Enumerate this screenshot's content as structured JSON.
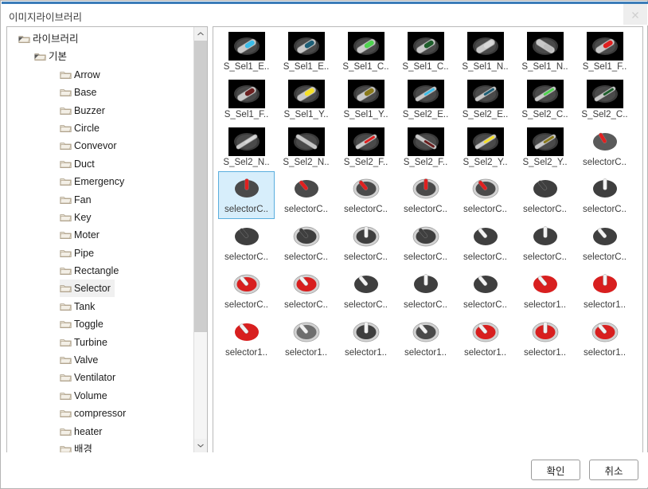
{
  "window": {
    "title": "이미지라이브러리",
    "close_icon": "close-icon"
  },
  "tree": {
    "nodes": [
      {
        "label": "라이브러리",
        "level": 0,
        "expanded": true,
        "selected": false
      },
      {
        "label": "기본",
        "level": 1,
        "expanded": true,
        "selected": false
      },
      {
        "label": "Arrow",
        "level": 2,
        "expanded": null,
        "selected": false
      },
      {
        "label": "Base",
        "level": 2,
        "expanded": null,
        "selected": false
      },
      {
        "label": "Buzzer",
        "level": 2,
        "expanded": null,
        "selected": false
      },
      {
        "label": "Circle",
        "level": 2,
        "expanded": null,
        "selected": false
      },
      {
        "label": "Convevor",
        "level": 2,
        "expanded": null,
        "selected": false
      },
      {
        "label": "Duct",
        "level": 2,
        "expanded": null,
        "selected": false
      },
      {
        "label": "Emergency",
        "level": 2,
        "expanded": null,
        "selected": false
      },
      {
        "label": "Fan",
        "level": 2,
        "expanded": null,
        "selected": false
      },
      {
        "label": "Key",
        "level": 2,
        "expanded": null,
        "selected": false
      },
      {
        "label": "Moter",
        "level": 2,
        "expanded": null,
        "selected": false
      },
      {
        "label": "Pipe",
        "level": 2,
        "expanded": null,
        "selected": false
      },
      {
        "label": "Rectangle",
        "level": 2,
        "expanded": null,
        "selected": false
      },
      {
        "label": "Selector",
        "level": 2,
        "expanded": null,
        "selected": true
      },
      {
        "label": "Tank",
        "level": 2,
        "expanded": null,
        "selected": false
      },
      {
        "label": "Toggle",
        "level": 2,
        "expanded": null,
        "selected": false
      },
      {
        "label": "Turbine",
        "level": 2,
        "expanded": null,
        "selected": false
      },
      {
        "label": "Valve",
        "level": 2,
        "expanded": null,
        "selected": false
      },
      {
        "label": "Ventilator",
        "level": 2,
        "expanded": null,
        "selected": false
      },
      {
        "label": "Volume",
        "level": 2,
        "expanded": null,
        "selected": false
      },
      {
        "label": "compressor",
        "level": 2,
        "expanded": null,
        "selected": false
      },
      {
        "label": "heater",
        "level": 2,
        "expanded": null,
        "selected": false
      },
      {
        "label": "배경",
        "level": 2,
        "expanded": null,
        "selected": false
      }
    ],
    "scrollbar": {
      "up_icon": "chevron-up-icon",
      "down_icon": "chevron-down-icon"
    }
  },
  "grid": {
    "items": [
      {
        "label": "S_Sel1_E..",
        "style": "bar",
        "bg": "dark",
        "knob": "#3bbce8",
        "angle": -32,
        "bezel": "none"
      },
      {
        "label": "S_Sel1_E..",
        "style": "bar",
        "bg": "dark",
        "knob": "#1d5f77",
        "angle": -32,
        "bezel": "none"
      },
      {
        "label": "S_Sel1_C..",
        "style": "bar",
        "bg": "dark",
        "knob": "#4fd24f",
        "angle": -32,
        "bezel": "none"
      },
      {
        "label": "S_Sel1_C..",
        "style": "bar",
        "bg": "dark",
        "knob": "#1f5e2c",
        "angle": -32,
        "bezel": "none"
      },
      {
        "label": "S_Sel1_N..",
        "style": "bar",
        "bg": "dark",
        "knob": "#d8d8d8",
        "angle": -32,
        "bezel": "none"
      },
      {
        "label": "S_Sel1_N..",
        "style": "bar",
        "bg": "dark",
        "knob": "#bdbdbd",
        "angle": 32,
        "bezel": "none"
      },
      {
        "label": "S_Sel1_F..",
        "style": "bar",
        "bg": "dark",
        "knob": "#e02020",
        "angle": -32,
        "bezel": "none"
      },
      {
        "label": "S_Sel1_F..",
        "style": "bar",
        "bg": "dark",
        "knob": "#6b2020",
        "angle": -32,
        "bezel": "none"
      },
      {
        "label": "S_Sel1_Y..",
        "style": "bar",
        "bg": "dark",
        "knob": "#f5e028",
        "angle": -32,
        "bezel": "none"
      },
      {
        "label": "S_Sel1_Y..",
        "style": "bar",
        "bg": "dark",
        "knob": "#8a7a1c",
        "angle": -32,
        "bezel": "none"
      },
      {
        "label": "S_Sel2_E..",
        "style": "slim",
        "bg": "dark",
        "knob": "#3bbce8",
        "angle": -32,
        "bezel": "none"
      },
      {
        "label": "S_Sel2_E..",
        "style": "slim",
        "bg": "dark",
        "knob": "#1d5f77",
        "angle": -32,
        "bezel": "none"
      },
      {
        "label": "S_Sel2_C..",
        "style": "slim",
        "bg": "dark",
        "knob": "#4fd24f",
        "angle": -32,
        "bezel": "none"
      },
      {
        "label": "S_Sel2_C..",
        "style": "slim",
        "bg": "dark",
        "knob": "#1f5e2c",
        "angle": -32,
        "bezel": "none"
      },
      {
        "label": "S_Sel2_N..",
        "style": "slim",
        "bg": "dark",
        "knob": "#d8d8d8",
        "angle": -32,
        "bezel": "none"
      },
      {
        "label": "S_Sel2_N..",
        "style": "slim",
        "bg": "dark",
        "knob": "#c4c4c4",
        "angle": 32,
        "bezel": "none"
      },
      {
        "label": "S_Sel2_F..",
        "style": "slim",
        "bg": "dark",
        "knob": "#e02020",
        "angle": -32,
        "bezel": "none"
      },
      {
        "label": "S_Sel2_F..",
        "style": "slim",
        "bg": "dark",
        "knob": "#6b2020",
        "angle": 32,
        "bezel": "none"
      },
      {
        "label": "S_Sel2_Y..",
        "style": "slim",
        "bg": "dark",
        "knob": "#f5e028",
        "angle": -32,
        "bezel": "none"
      },
      {
        "label": "S_Sel2_Y..",
        "style": "slim",
        "bg": "dark",
        "knob": "#8a7a1c",
        "angle": -32,
        "bezel": "none"
      },
      {
        "label": "selectorC..",
        "style": "knob",
        "bg": "light",
        "dial": "#5a5a5a",
        "knob": "#e02020",
        "angle": -32,
        "bezel": "none"
      },
      {
        "label": "selectorC..",
        "style": "knob",
        "bg": "light",
        "dial": "#4a4a4a",
        "knob": "#e02020",
        "angle": 0,
        "bezel": "none",
        "selected": true
      },
      {
        "label": "selectorC..",
        "style": "knob",
        "bg": "light",
        "dial": "#4a4a4a",
        "knob": "#e02020",
        "angle": -40,
        "bezel": "none"
      },
      {
        "label": "selectorC..",
        "style": "knob",
        "bg": "light",
        "dial": "#4a4a4a",
        "knob": "#e02020",
        "angle": -40,
        "bezel": "silver"
      },
      {
        "label": "selectorC..",
        "style": "knob",
        "bg": "light",
        "dial": "#4a4a4a",
        "knob": "#e02020",
        "angle": 0,
        "bezel": "silver"
      },
      {
        "label": "selectorC..",
        "style": "knob",
        "bg": "light",
        "dial": "#4a4a4a",
        "knob": "#e02020",
        "angle": -40,
        "bezel": "silver"
      },
      {
        "label": "selectorC..",
        "style": "knob",
        "bg": "light",
        "dial": "#3f3f3f",
        "knob": "#3f3f3f",
        "angle": -40,
        "bezel": "none"
      },
      {
        "label": "selectorC..",
        "style": "knob",
        "bg": "light",
        "dial": "#3f3f3f",
        "knob": "#f2f2f2",
        "angle": 0,
        "bezel": "none"
      },
      {
        "label": "selectorC..",
        "style": "knob",
        "bg": "light",
        "dial": "#3f3f3f",
        "knob": "#3f3f3f",
        "angle": -40,
        "bezel": "none"
      },
      {
        "label": "selectorC..",
        "style": "knob",
        "bg": "light",
        "dial": "#3f3f3f",
        "knob": "#3f3f3f",
        "angle": -40,
        "bezel": "silver"
      },
      {
        "label": "selectorC..",
        "style": "knob",
        "bg": "light",
        "dial": "#3f3f3f",
        "knob": "#f2f2f2",
        "angle": 0,
        "bezel": "silver"
      },
      {
        "label": "selectorC..",
        "style": "knob",
        "bg": "light",
        "dial": "#3f3f3f",
        "knob": "#3f3f3f",
        "angle": -40,
        "bezel": "silver"
      },
      {
        "label": "selectorC..",
        "style": "knob",
        "bg": "light",
        "dial": "#3f3f3f",
        "knob": "#f2f2f2",
        "angle": -40,
        "bezel": "none"
      },
      {
        "label": "selectorC..",
        "style": "knob",
        "bg": "light",
        "dial": "#3f3f3f",
        "knob": "#f2f2f2",
        "angle": 0,
        "bezel": "none"
      },
      {
        "label": "selectorC..",
        "style": "knob",
        "bg": "light",
        "dial": "#3f3f3f",
        "knob": "#f2f2f2",
        "angle": -40,
        "bezel": "none"
      },
      {
        "label": "selectorC..",
        "style": "knob",
        "bg": "light",
        "dial": "#d81f1f",
        "knob": "#f2f2f2",
        "angle": -40,
        "bezel": "silver"
      },
      {
        "label": "selectorC..",
        "style": "knob",
        "bg": "light",
        "dial": "#d81f1f",
        "knob": "#f2f2f2",
        "angle": -40,
        "bezel": "silver"
      },
      {
        "label": "selectorC..",
        "style": "knob",
        "bg": "light",
        "dial": "#3f3f3f",
        "knob": "#f2f2f2",
        "angle": -40,
        "bezel": "none"
      },
      {
        "label": "selectorC..",
        "style": "knob",
        "bg": "light",
        "dial": "#3f3f3f",
        "knob": "#f2f2f2",
        "angle": 0,
        "bezel": "none"
      },
      {
        "label": "selectorC..",
        "style": "knob",
        "bg": "light",
        "dial": "#3f3f3f",
        "knob": "#f2f2f2",
        "angle": -40,
        "bezel": "none"
      },
      {
        "label": "selector1..",
        "style": "knob",
        "bg": "light",
        "dial": "#d81f1f",
        "knob": "#f2f2f2",
        "angle": -40,
        "bezel": "none"
      },
      {
        "label": "selector1..",
        "style": "knob",
        "bg": "light",
        "dial": "#d81f1f",
        "knob": "#f2f2f2",
        "angle": 0,
        "bezel": "none"
      },
      {
        "label": "selector1..",
        "style": "knob",
        "bg": "light",
        "dial": "#d81f1f",
        "knob": "#f2f2f2",
        "angle": -40,
        "bezel": "none"
      },
      {
        "label": "selector1..",
        "style": "knob",
        "bg": "light",
        "dial": "#6e6e6e",
        "knob": "#f2f2f2",
        "angle": -40,
        "bezel": "silver"
      },
      {
        "label": "selector1..",
        "style": "knob",
        "bg": "light",
        "dial": "#3f3f3f",
        "knob": "#f2f2f2",
        "angle": 0,
        "bezel": "silver"
      },
      {
        "label": "selector1..",
        "style": "knob",
        "bg": "light",
        "dial": "#4a4a4a",
        "knob": "#f2f2f2",
        "angle": -40,
        "bezel": "silver"
      },
      {
        "label": "selector1..",
        "style": "knob",
        "bg": "light",
        "dial": "#d81f1f",
        "knob": "#f2f2f2",
        "angle": -40,
        "bezel": "silver"
      },
      {
        "label": "selector1..",
        "style": "knob",
        "bg": "light",
        "dial": "#d81f1f",
        "knob": "#f2f2f2",
        "angle": 0,
        "bezel": "silver"
      },
      {
        "label": "selector1..",
        "style": "knob",
        "bg": "light",
        "dial": "#d81f1f",
        "knob": "#f2f2f2",
        "angle": -40,
        "bezel": "silver"
      }
    ]
  },
  "footer": {
    "ok_label": "확인",
    "cancel_label": "취소"
  },
  "colors": {
    "title_accent": "#3b7cb8",
    "selection_bg": "#d7eefb",
    "selection_border": "#5aaede",
    "panel_border": "#b9b9b9"
  }
}
